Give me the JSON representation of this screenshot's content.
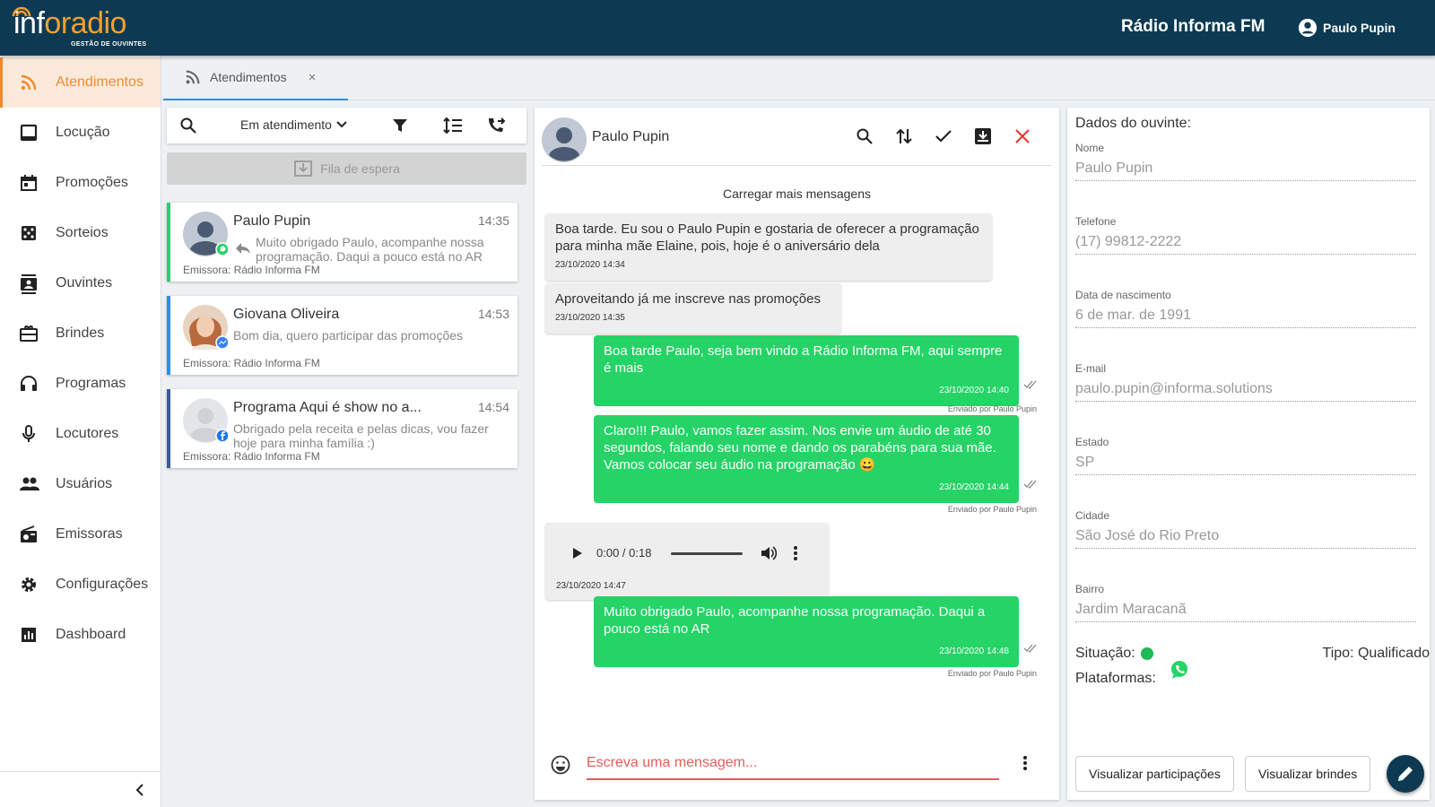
{
  "brand": {
    "logo_text_1": "inf",
    "logo_text_2": "oradio",
    "tagline": "GESTÃO DE OUVINTES",
    "accent": "#f08a2c",
    "topbar_color": "#0d3a52"
  },
  "header": {
    "station": "Rádio Informa FM",
    "user": "Paulo Pupin"
  },
  "sidebar": {
    "items": [
      {
        "label": "Atendimentos",
        "icon": "rss-feed-icon",
        "active": true
      },
      {
        "label": "Locução",
        "icon": "tablet-icon"
      },
      {
        "label": "Promoções",
        "icon": "calendar-icon"
      },
      {
        "label": "Sorteios",
        "icon": "dice-icon"
      },
      {
        "label": "Ouvintes",
        "icon": "contacts-icon"
      },
      {
        "label": "Brindes",
        "icon": "gift-card-icon"
      },
      {
        "label": "Programas",
        "icon": "headphones-icon"
      },
      {
        "label": "Locutores",
        "icon": "microphone-icon"
      },
      {
        "label": "Usuários",
        "icon": "people-icon"
      },
      {
        "label": "Emissoras",
        "icon": "radio-icon"
      },
      {
        "label": "Configurações",
        "icon": "gear-icon"
      },
      {
        "label": "Dashboard",
        "icon": "dashboard-icon"
      }
    ]
  },
  "tabs": [
    {
      "label": "Atendimentos",
      "close": "×"
    }
  ],
  "list": {
    "filter": "Em atendimento",
    "queue_label": "Fila de espera",
    "conversations": [
      {
        "name": "Paulo Pupin",
        "time": "14:35",
        "preview": "Muito obrigado Paulo, acompanhe nossa programação. Daqui a pouco está no AR",
        "emissora": "Emissora: Rádio Informa FM",
        "platform": "whatsapp",
        "color": "#2ecc71"
      },
      {
        "name": "Giovana Oliveira",
        "time": "14:53",
        "preview": "Bom dia, quero participar das promoções",
        "emissora": "Emissora: Rádio Informa FM",
        "platform": "messenger",
        "color": "#2f8ce6"
      },
      {
        "name": "Programa Aqui é show no a...",
        "time": "14:54",
        "preview": "Obrigado pela receita e pelas dicas, vou fazer hoje para minha família :)",
        "emissora": "Emissora: Rádio Informa FM",
        "platform": "facebook",
        "color": "#3b5b9a"
      }
    ]
  },
  "chat": {
    "contact": "Paulo Pupin",
    "load_more": "Carregar mais mensagens",
    "messages": [
      {
        "dir": "in",
        "text": "Boa tarde. Eu sou o Paulo Pupin e gostaria de oferecer a programação para minha mãe Elaine, pois, hoje é o aniversário dela",
        "date": "23/10/2020 14:34"
      },
      {
        "dir": "in",
        "text": "Aproveitando já me inscreve nas promoções",
        "date": "23/10/2020 14:35"
      },
      {
        "dir": "out",
        "text": "Boa tarde Paulo, seja bem vindo a Rádio Informa FM, aqui sempre é mais",
        "date": "23/10/2020 14:40",
        "sent_by": "Enviado por Paulo Pupin"
      },
      {
        "dir": "out",
        "text": "Claro!!! Paulo, vamos fazer assim. Nos envie um áudio de até 30 segundos, falando seu nome e dando os parabéns para sua mãe. Vamos colocar seu áudio na programação 😀",
        "date": "23/10/2020 14:44",
        "sent_by": "Enviado por Paulo Pupin"
      },
      {
        "dir": "out",
        "text": "Muito obrigado Paulo, acompanhe nossa programação. Daqui a pouco está no AR",
        "date": "23/10/2020 14:48",
        "sent_by": "Enviado por Paulo Pupin"
      }
    ],
    "audio": {
      "time": "0:00 / 0:18",
      "progress": 0,
      "date": "23/10/2020 14:47"
    },
    "input_placeholder": "Escreva uma mensagem..."
  },
  "details": {
    "title": "Dados do ouvinte:",
    "fields": [
      {
        "label": "Nome",
        "value": "Paulo Pupin"
      },
      {
        "label": "Telefone",
        "value": "(17) 99812-2222"
      },
      {
        "label": "Data de nascimento",
        "value": "6 de mar. de 1991"
      },
      {
        "label": "E-mail",
        "value": "paulo.pupin@informa.solutions"
      },
      {
        "label": "Estado",
        "value": "SP"
      },
      {
        "label": "Cidade",
        "value": "São José do Rio Preto"
      },
      {
        "label": "Bairro",
        "value": "Jardim Maracanã"
      }
    ],
    "situacao_label": "Situação:",
    "situacao_color": "#1db954",
    "tipo": "Tipo: Qualificado",
    "plataformas_label": "Plataformas:",
    "btn_participacoes": "Visualizar participações",
    "btn_brindes": "Visualizar brindes"
  }
}
